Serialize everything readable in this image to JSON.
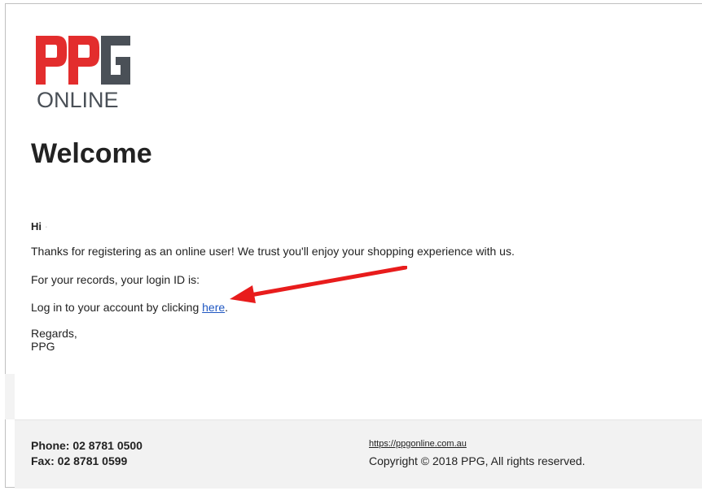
{
  "brand": {
    "logo_letters": "PPG",
    "logo_subtitle": "ONLINE",
    "colors": {
      "red": "#e32d2d",
      "gray": "#4a5057"
    }
  },
  "email": {
    "title": "Welcome",
    "greeting": "Hi",
    "greeting_trailing": "·",
    "paragraph_1": "Thanks for registering as an online user! We trust you'll enjoy your shopping experience with us.",
    "paragraph_2": "For your records, your login ID is:",
    "login_prefix": "Log in to your account by clicking ",
    "login_link": "here",
    "login_suffix": ".",
    "regards": "Regards,",
    "signature": "PPG"
  },
  "annotation": {
    "arrow_color": "#e81c1c",
    "points_to": "here"
  },
  "footer": {
    "phone": "Phone: 02 8781 0500",
    "fax": "Fax: 02 8781 0599",
    "website": "https://ppgonline.com.au",
    "copyright": "Copyright © 2018 PPG, All rights reserved."
  }
}
